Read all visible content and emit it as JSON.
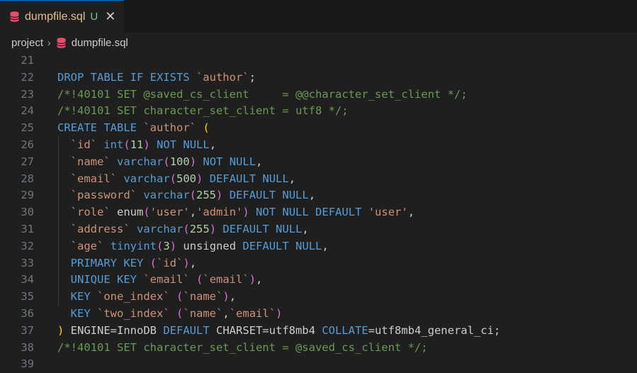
{
  "tab": {
    "filename": "dumpfile.sql",
    "status": "U",
    "close": "✕"
  },
  "breadcrumb": {
    "folder": "project",
    "separator": "›",
    "file": "dumpfile.sql"
  },
  "editor": {
    "lines": [
      {
        "num": "21",
        "tokens": []
      },
      {
        "num": "22",
        "tokens": [
          [
            "kw",
            "DROP TABLE IF EXISTS "
          ],
          [
            "st",
            "`author`"
          ],
          [
            "tx",
            ";"
          ]
        ]
      },
      {
        "num": "23",
        "tokens": [
          [
            "cm",
            "/*!40101 SET @saved_cs_client     = @@character_set_client */;"
          ]
        ]
      },
      {
        "num": "24",
        "tokens": [
          [
            "cm",
            "/*!40101 SET character_set_client = utf8 */;"
          ]
        ]
      },
      {
        "num": "25",
        "tokens": [
          [
            "kw",
            "CREATE TABLE "
          ],
          [
            "st",
            "`author`"
          ],
          [
            "tx",
            " "
          ],
          [
            "pb",
            "("
          ]
        ]
      },
      {
        "num": "26",
        "tokens": [
          [
            "tx",
            "  "
          ],
          [
            "st",
            "`id`"
          ],
          [
            "tx",
            " "
          ],
          [
            "kw",
            "int"
          ],
          [
            "pp",
            "("
          ],
          [
            "nu",
            "11"
          ],
          [
            "pp",
            ")"
          ],
          [
            "tx",
            " "
          ],
          [
            "kw",
            "NOT NULL"
          ],
          [
            "tx",
            ","
          ]
        ]
      },
      {
        "num": "27",
        "tokens": [
          [
            "tx",
            "  "
          ],
          [
            "st",
            "`name`"
          ],
          [
            "tx",
            " "
          ],
          [
            "kw",
            "varchar"
          ],
          [
            "pp",
            "("
          ],
          [
            "nu",
            "100"
          ],
          [
            "pp",
            ")"
          ],
          [
            "tx",
            " "
          ],
          [
            "kw",
            "NOT NULL"
          ],
          [
            "tx",
            ","
          ]
        ]
      },
      {
        "num": "28",
        "tokens": [
          [
            "tx",
            "  "
          ],
          [
            "st",
            "`email`"
          ],
          [
            "tx",
            " "
          ],
          [
            "kw",
            "varchar"
          ],
          [
            "pp",
            "("
          ],
          [
            "nu",
            "500"
          ],
          [
            "pp",
            ")"
          ],
          [
            "tx",
            " "
          ],
          [
            "kw",
            "DEFAULT NULL"
          ],
          [
            "tx",
            ","
          ]
        ]
      },
      {
        "num": "29",
        "tokens": [
          [
            "tx",
            "  "
          ],
          [
            "st",
            "`password`"
          ],
          [
            "tx",
            " "
          ],
          [
            "kw",
            "varchar"
          ],
          [
            "pp",
            "("
          ],
          [
            "nu",
            "255"
          ],
          [
            "pp",
            ")"
          ],
          [
            "tx",
            " "
          ],
          [
            "kw",
            "DEFAULT NULL"
          ],
          [
            "tx",
            ","
          ]
        ]
      },
      {
        "num": "30",
        "tokens": [
          [
            "tx",
            "  "
          ],
          [
            "st",
            "`role`"
          ],
          [
            "tx",
            " enum"
          ],
          [
            "pp",
            "("
          ],
          [
            "st",
            "'user'"
          ],
          [
            "tx",
            ","
          ],
          [
            "st",
            "'admin'"
          ],
          [
            "pp",
            ")"
          ],
          [
            "tx",
            " "
          ],
          [
            "kw",
            "NOT NULL DEFAULT"
          ],
          [
            "tx",
            " "
          ],
          [
            "st",
            "'user'"
          ],
          [
            "tx",
            ","
          ]
        ]
      },
      {
        "num": "31",
        "tokens": [
          [
            "tx",
            "  "
          ],
          [
            "st",
            "`address`"
          ],
          [
            "tx",
            " "
          ],
          [
            "kw",
            "varchar"
          ],
          [
            "pp",
            "("
          ],
          [
            "nu",
            "255"
          ],
          [
            "pp",
            ")"
          ],
          [
            "tx",
            " "
          ],
          [
            "kw",
            "DEFAULT NULL"
          ],
          [
            "tx",
            ","
          ]
        ]
      },
      {
        "num": "32",
        "tokens": [
          [
            "tx",
            "  "
          ],
          [
            "st",
            "`age`"
          ],
          [
            "tx",
            " "
          ],
          [
            "kw",
            "tinyint"
          ],
          [
            "pp",
            "("
          ],
          [
            "nu",
            "3"
          ],
          [
            "pp",
            ")"
          ],
          [
            "tx",
            " unsigned "
          ],
          [
            "kw",
            "DEFAULT NULL"
          ],
          [
            "tx",
            ","
          ]
        ]
      },
      {
        "num": "33",
        "tokens": [
          [
            "tx",
            "  "
          ],
          [
            "kw",
            "PRIMARY KEY"
          ],
          [
            "tx",
            " "
          ],
          [
            "pp",
            "("
          ],
          [
            "st",
            "`id`"
          ],
          [
            "pp",
            ")"
          ],
          [
            "tx",
            ","
          ]
        ]
      },
      {
        "num": "34",
        "tokens": [
          [
            "tx",
            "  "
          ],
          [
            "kw",
            "UNIQUE KEY"
          ],
          [
            "tx",
            " "
          ],
          [
            "st",
            "`email`"
          ],
          [
            "tx",
            " "
          ],
          [
            "pp",
            "("
          ],
          [
            "st",
            "`email`"
          ],
          [
            "pp",
            ")"
          ],
          [
            "tx",
            ","
          ]
        ]
      },
      {
        "num": "35",
        "tokens": [
          [
            "tx",
            "  "
          ],
          [
            "kw",
            "KEY"
          ],
          [
            "tx",
            " "
          ],
          [
            "st",
            "`one_index`"
          ],
          [
            "tx",
            " "
          ],
          [
            "pp",
            "("
          ],
          [
            "st",
            "`name`"
          ],
          [
            "pp",
            ")"
          ],
          [
            "tx",
            ","
          ]
        ]
      },
      {
        "num": "36",
        "tokens": [
          [
            "tx",
            "  "
          ],
          [
            "kw",
            "KEY"
          ],
          [
            "tx",
            " "
          ],
          [
            "st",
            "`two_index`"
          ],
          [
            "tx",
            " "
          ],
          [
            "pp",
            "("
          ],
          [
            "st",
            "`name`"
          ],
          [
            "tx",
            ","
          ],
          [
            "st",
            "`email`"
          ],
          [
            "pp",
            ")"
          ]
        ]
      },
      {
        "num": "37",
        "tokens": [
          [
            "pb",
            ")"
          ],
          [
            "tx",
            " ENGINE=InnoDB "
          ],
          [
            "kw",
            "DEFAULT"
          ],
          [
            "tx",
            " CHARSET=utf8mb4 "
          ],
          [
            "kw",
            "COLLATE"
          ],
          [
            "tx",
            "=utf8mb4_general_ci;"
          ]
        ]
      },
      {
        "num": "38",
        "tokens": [
          [
            "cm",
            "/*!40101 SET character_set_client = @saved_cs_client */;"
          ]
        ]
      },
      {
        "num": "39",
        "tokens": []
      }
    ]
  }
}
